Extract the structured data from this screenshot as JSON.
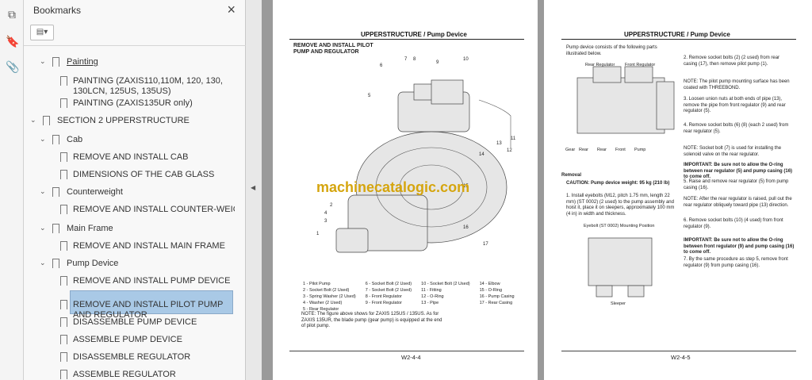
{
  "sidebar": {
    "title": "Bookmarks",
    "close": "×",
    "options_icon": "▤▾",
    "items": [
      {
        "label": "Painting",
        "level": 1
      },
      {
        "label": "PAINTING (ZAXIS110,110M, 120, 130, 130LCN, 125US, 135US)",
        "level": 2
      },
      {
        "label": "PAINTING (ZAXIS135UR only)",
        "level": 2
      },
      {
        "label": "SECTION 2 UPPERSTRUCTURE",
        "level": 0
      },
      {
        "label": "Cab",
        "level": 1
      },
      {
        "label": "REMOVE AND INSTALL CAB",
        "level": 2
      },
      {
        "label": "DIMENSIONS OF THE CAB GLASS",
        "level": 2
      },
      {
        "label": "Counterweight",
        "level": 1
      },
      {
        "label": "REMOVE AND INSTALL COUNTER-WEIGHT",
        "level": 2
      },
      {
        "label": "Main Frame",
        "level": 1
      },
      {
        "label": "REMOVE AND INSTALL MAIN FRAME",
        "level": 2
      },
      {
        "label": "Pump Device",
        "level": 1
      },
      {
        "label": "REMOVE AND INSTALL PUMP DEVICE",
        "level": 2
      },
      {
        "label": "REMOVE AND INSTALL PILOT PUMP AND REGULATOR",
        "level": 2
      },
      {
        "label": "DISASSEMBLE PUMP DEVICE",
        "level": 2
      },
      {
        "label": "ASSEMBLE PUMP DEVICE",
        "level": 2
      },
      {
        "label": "DISASSEMBLE REGULATOR",
        "level": 2
      },
      {
        "label": "ASSEMBLE REGULATOR",
        "level": 2
      }
    ]
  },
  "page_left": {
    "header": "UPPERSTRUCTURE / Pump Device",
    "title": "REMOVE AND INSTALL PILOT PUMP AND REGULATOR",
    "watermark": "machinecatalogic.com",
    "legend": [
      [
        "1 - Pilot Pump",
        "6 - Socket Bolt (2 Used)",
        "10 - Socket Bolt (2 Used)",
        "14 - Elbow"
      ],
      [
        "2 - Socket Bolt (2 Used)",
        "7 - Socket Bolt (2 Used)",
        "11 - Fitting",
        "15 - O-Ring"
      ],
      [
        "3 - Spring Washer (2 Used)",
        "8 - Front Regulator",
        "12 - O-Ring",
        "16 - Pump Casing"
      ],
      [
        "4 - Washer (2 Used)",
        "9 - Front Regulator",
        "13 - Pipe",
        "17 - Rear Casing"
      ],
      [
        "5 - Rear Regulator",
        "",
        "",
        ""
      ]
    ],
    "note": "NOTE: The figure above shows for ZAXIS 125US / 135US. As for ZAXIS 135UR, the blade pump (gear pump) is equipped at the end of pilot pump.",
    "footer": "W2-4-4"
  },
  "page_right": {
    "header": "UPPERSTRUCTURE / Pump Device",
    "intro": "Pump device consists of the following parts illustrated below.",
    "footer": "W2-4-5",
    "removal": "Removal",
    "caution": "CAUTION: Pump device weight: 95 kg (210 lb)",
    "steps": [
      "1. Install eyebolts (M12, pitch 1.75 mm, length 22 mm) (ST 0002) (2 used) to the pump assembly and hoist it, place it on sleepers, approximately 100 mm (4 in) in width and thickness.",
      "2. Remove socket bolts (2) (2 used) from rear casing (17), then remove pilot pump (1).",
      "NOTE: The pilot pump mounting surface has been coated with THREEBOND.",
      "3. Loosen union nuts at both ends of pipe (13), remove the pipe from front regulator (9) and rear regulator (5).",
      "4. Remove socket bolts (6) (8) (each 2 used) from rear regulator (5).",
      "NOTE: Socket bolt (7) is used for installing the solenoid valve on the rear regulator.",
      "IMPORTANT: Be sure not to allow the O-ring between rear regulator (5) and pump casing (16) to come off.",
      "5. Raise and remove rear regulator (5) from pump casing (16).",
      "NOTE: After the rear regulator is raised, pull out the rear regulator obliquely toward pipe (13) direction.",
      "6. Remove socket bolts (10) (4 used) from front regulator (9).",
      "IMPORTANT: Be sure not to allow the O-ring between front regulator (9) and pump casing (16) to come off.",
      "7. By the same procedure as step 5, remove front regulator (9) from pump casing (16)."
    ]
  }
}
